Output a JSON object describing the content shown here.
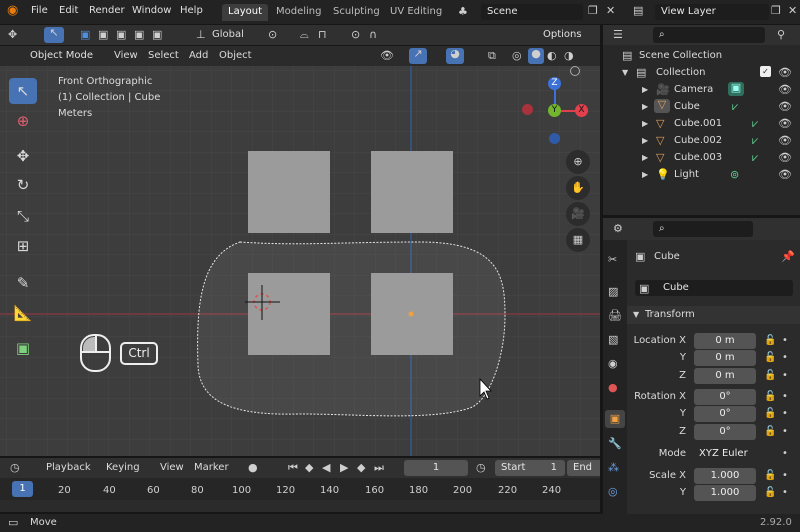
{
  "menu": [
    "File",
    "Edit",
    "Render",
    "Window",
    "Help"
  ],
  "workspaces": [
    {
      "label": "Layout",
      "active": true
    },
    {
      "label": "Modeling",
      "active": false
    },
    {
      "label": "Sculpting",
      "active": false
    },
    {
      "label": "UV Editing",
      "active": false
    }
  ],
  "scene_name": "Scene",
  "view_layer": "View Layer",
  "viewport_header": {
    "mode": "Object Mode",
    "menus": [
      "View",
      "Select",
      "Add",
      "Object"
    ],
    "orientation": "Global",
    "options": "Options"
  },
  "overlay_text": {
    "view": "Front Orthographic",
    "collection": "(1) Collection | Cube",
    "units": "Meters"
  },
  "gizmo_axes": {
    "z": "Z",
    "y": "Y",
    "x": "X"
  },
  "keys_hint": "Ctrl",
  "outliner": {
    "scene_collection": "Scene Collection",
    "items": [
      {
        "label": "Collection",
        "icon": "collection-icon"
      },
      {
        "label": "Camera",
        "icon": "camera-icon"
      },
      {
        "label": "Cube",
        "icon": "mesh-icon"
      },
      {
        "label": "Cube.001",
        "icon": "mesh-icon"
      },
      {
        "label": "Cube.002",
        "icon": "mesh-icon"
      },
      {
        "label": "Cube.003",
        "icon": "mesh-icon"
      },
      {
        "label": "Light",
        "icon": "light-icon"
      }
    ]
  },
  "properties": {
    "object_name": "Cube",
    "datablock": "Cube",
    "panel": "Transform",
    "location": {
      "label": "Location X",
      "y": "Y",
      "z": "Z",
      "values": [
        "0 m",
        "0 m",
        "0 m"
      ]
    },
    "rotation": {
      "label": "Rotation X",
      "y": "Y",
      "z": "Z",
      "values": [
        "0°",
        "0°",
        "0°"
      ]
    },
    "mode": {
      "label": "Mode",
      "value": "XYZ Euler"
    },
    "scale": {
      "label": "Scale X",
      "y": "Y",
      "values": [
        "1.000",
        "1.000"
      ]
    }
  },
  "timeline": {
    "menus": [
      "Playback",
      "Keying",
      "View",
      "Marker"
    ],
    "current_frame": "1",
    "start_label": "Start",
    "start_value": "1",
    "end_label": "End",
    "ticks": [
      "1",
      "20",
      "40",
      "60",
      "80",
      "100",
      "120",
      "140",
      "160",
      "180",
      "200",
      "220",
      "240"
    ]
  },
  "status": {
    "action": "Move",
    "version": "2.92.0"
  },
  "colors": {
    "accent": "#4772b3",
    "x_axis": "#e2404d",
    "y_axis": "#72b52f",
    "z_axis": "#3c72d8",
    "active_ws": "#3d3d3d"
  }
}
